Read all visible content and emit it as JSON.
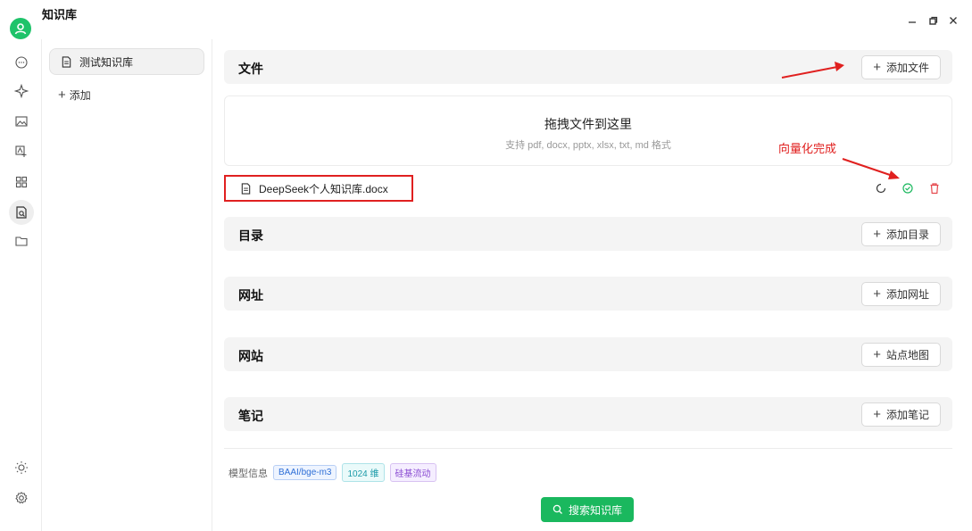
{
  "app": {
    "title": "知识库",
    "window_controls": [
      "minimize-icon",
      "restore-icon",
      "close-icon"
    ]
  },
  "rail": {
    "icons": [
      "chat-icon",
      "sparkle-icon",
      "image-icon",
      "translate-icon",
      "apps-icon",
      "knowledge-icon",
      "folder-icon"
    ],
    "bottom_icons": [
      "sun-icon",
      "settings-icon"
    ],
    "active": "knowledge-icon"
  },
  "kb_panel": {
    "items": [
      {
        "label": "测试知识库"
      }
    ],
    "add_label": "添加"
  },
  "main": {
    "sections": {
      "files": {
        "title": "文件",
        "button": "添加文件"
      },
      "directory": {
        "title": "目录",
        "button": "添加目录"
      },
      "url": {
        "title": "网址",
        "button": "添加网址"
      },
      "website": {
        "title": "网站",
        "button": "站点地图"
      },
      "notes": {
        "title": "笔记",
        "button": "添加笔记"
      }
    },
    "dropzone": {
      "title": "拖拽文件到这里",
      "subtitle": "支持 pdf, docx, pptx, xlsx, txt, md 格式"
    },
    "file": {
      "name": "DeepSeek个人知识库.docx",
      "actions": [
        "refresh-icon",
        "check-circle-icon",
        "trash-icon"
      ]
    },
    "annotation": "向量化完成",
    "model_info": {
      "label": "模型信息",
      "tags": [
        "BAAI/bge-m3",
        "1024 维",
        "硅基流动"
      ]
    },
    "search_button": "搜索知识库"
  },
  "colors": {
    "accent": "#1ab85e",
    "annotation": "#e0201f",
    "delete": "#e5484d",
    "success": "#1ab85e"
  }
}
